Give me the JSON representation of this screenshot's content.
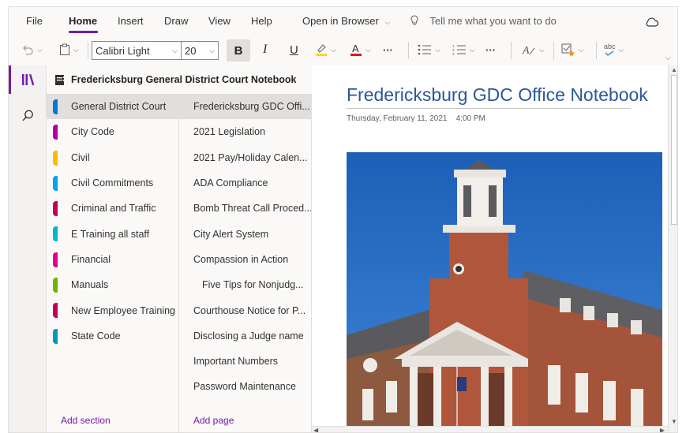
{
  "menu": {
    "file": "File",
    "home": "Home",
    "insert": "Insert",
    "draw": "Draw",
    "view": "View",
    "help": "Help",
    "open_in_browser": "Open in Browser",
    "tell_me": "Tell me what you want to do"
  },
  "ribbon": {
    "font_name": "Calibri Light",
    "font_size": "20",
    "bold": "B",
    "italic": "I",
    "underline": "U",
    "more": "···",
    "spell_label": "abc"
  },
  "notebook": {
    "title": "Fredericksburg General District Court Notebook"
  },
  "sections": [
    {
      "label": "General District Court",
      "color": "#0078d4"
    },
    {
      "label": "City Code",
      "color": "#b4009e"
    },
    {
      "label": "Civil",
      "color": "#ffb900"
    },
    {
      "label": "Civil Commitments",
      "color": "#00a4ef"
    },
    {
      "label": "Criminal and Traffic",
      "color": "#c30052"
    },
    {
      "label": "E Training all staff",
      "color": "#00b7c3"
    },
    {
      "label": "Financial",
      "color": "#e3008c"
    },
    {
      "label": "Manuals",
      "color": "#6bb700"
    },
    {
      "label": "New Employee Training",
      "color": "#c30052"
    },
    {
      "label": "State Code",
      "color": "#0099bc"
    }
  ],
  "add_section": "Add section",
  "pages": [
    "Fredericksburg GDC Offi...",
    "2021 Legislation",
    "2021 Pay/Holiday Calen...",
    "ADA Compliance",
    "Bomb Threat Call Proced...",
    "City Alert System",
    "Compassion in Action",
    "Five Tips for Nonjudg...",
    "Courthouse Notice for P...",
    "Disclosing a Judge name",
    "Important Numbers",
    "Password Maintenance"
  ],
  "add_page": "Add page",
  "canvas": {
    "title": "Fredericksburg GDC Office Notebook",
    "date": "Thursday, February 11, 2021",
    "time": "4:00 PM"
  }
}
